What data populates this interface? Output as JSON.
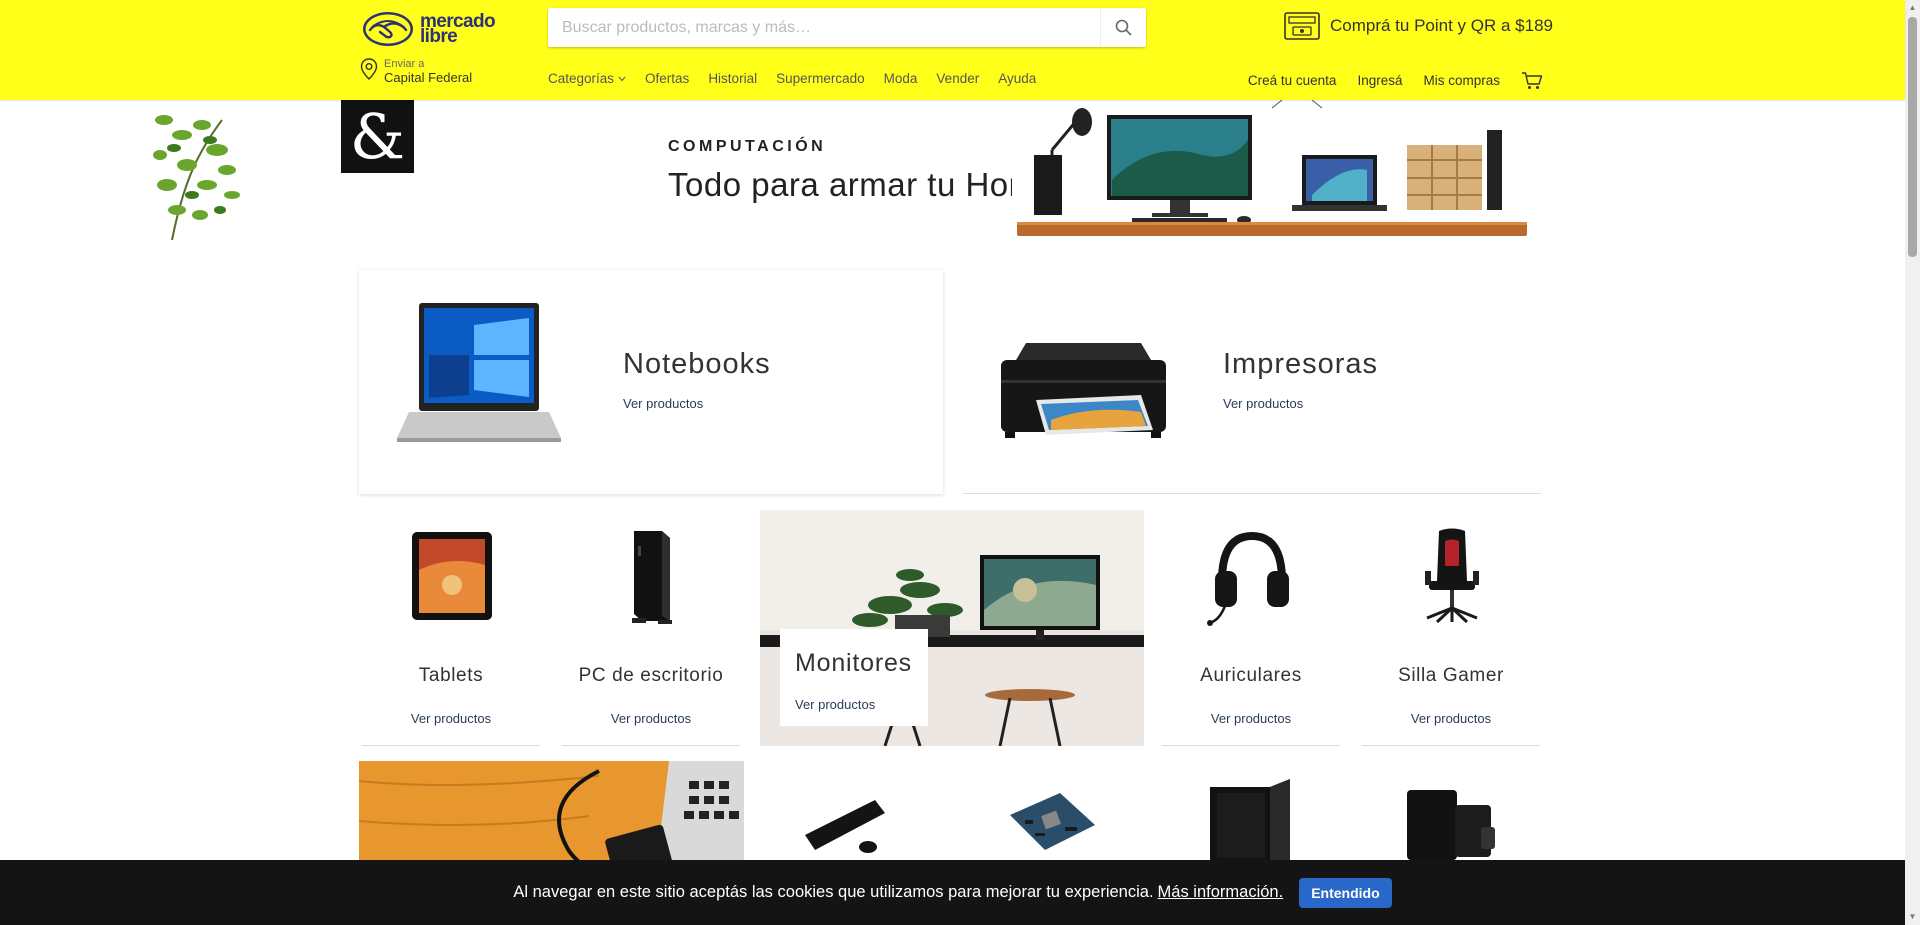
{
  "header": {
    "logo_text_line1": "mercado",
    "logo_text_line2": "libre",
    "search_placeholder": "Buscar productos, marcas y más…",
    "promo_text": "Comprá tu Point y QR a $189",
    "location_label": "Enviar a",
    "location_value": "Capital Federal",
    "nav": [
      {
        "label": "Categorías"
      },
      {
        "label": "Ofertas"
      },
      {
        "label": "Historial"
      },
      {
        "label": "Supermercado"
      },
      {
        "label": "Moda"
      },
      {
        "label": "Vender"
      },
      {
        "label": "Ayuda"
      }
    ],
    "account": {
      "create": "Creá tu cuenta",
      "login": "Ingresá",
      "purchases": "Mis compras"
    }
  },
  "banner": {
    "kicker": "COMPUTACIÓN",
    "title": "Todo para armar tu Home Office",
    "amp": "&"
  },
  "categories": {
    "notebooks": {
      "title": "Notebooks",
      "link": "Ver productos"
    },
    "impresoras": {
      "title": "Impresoras",
      "link": "Ver productos"
    },
    "tablets": {
      "title": "Tablets",
      "link": "Ver productos"
    },
    "pc": {
      "title": "PC de escritorio",
      "link": "Ver productos"
    },
    "monitores": {
      "title": "Monitores",
      "link": "Ver productos"
    },
    "auriculares": {
      "title": "Auriculares",
      "link": "Ver productos"
    },
    "silla": {
      "title": "Silla Gamer",
      "link": "Ver productos"
    }
  },
  "cookie": {
    "text": "Al navegar en este sitio aceptás las cookies que utilizamos para mejorar tu experiencia.",
    "link": "Más información.",
    "button": "Entendido"
  },
  "colors": {
    "header_bg": "#ffff1a",
    "cookie_bg": "#141414",
    "cookie_button": "#2968c8",
    "link": "#2b3a57"
  }
}
